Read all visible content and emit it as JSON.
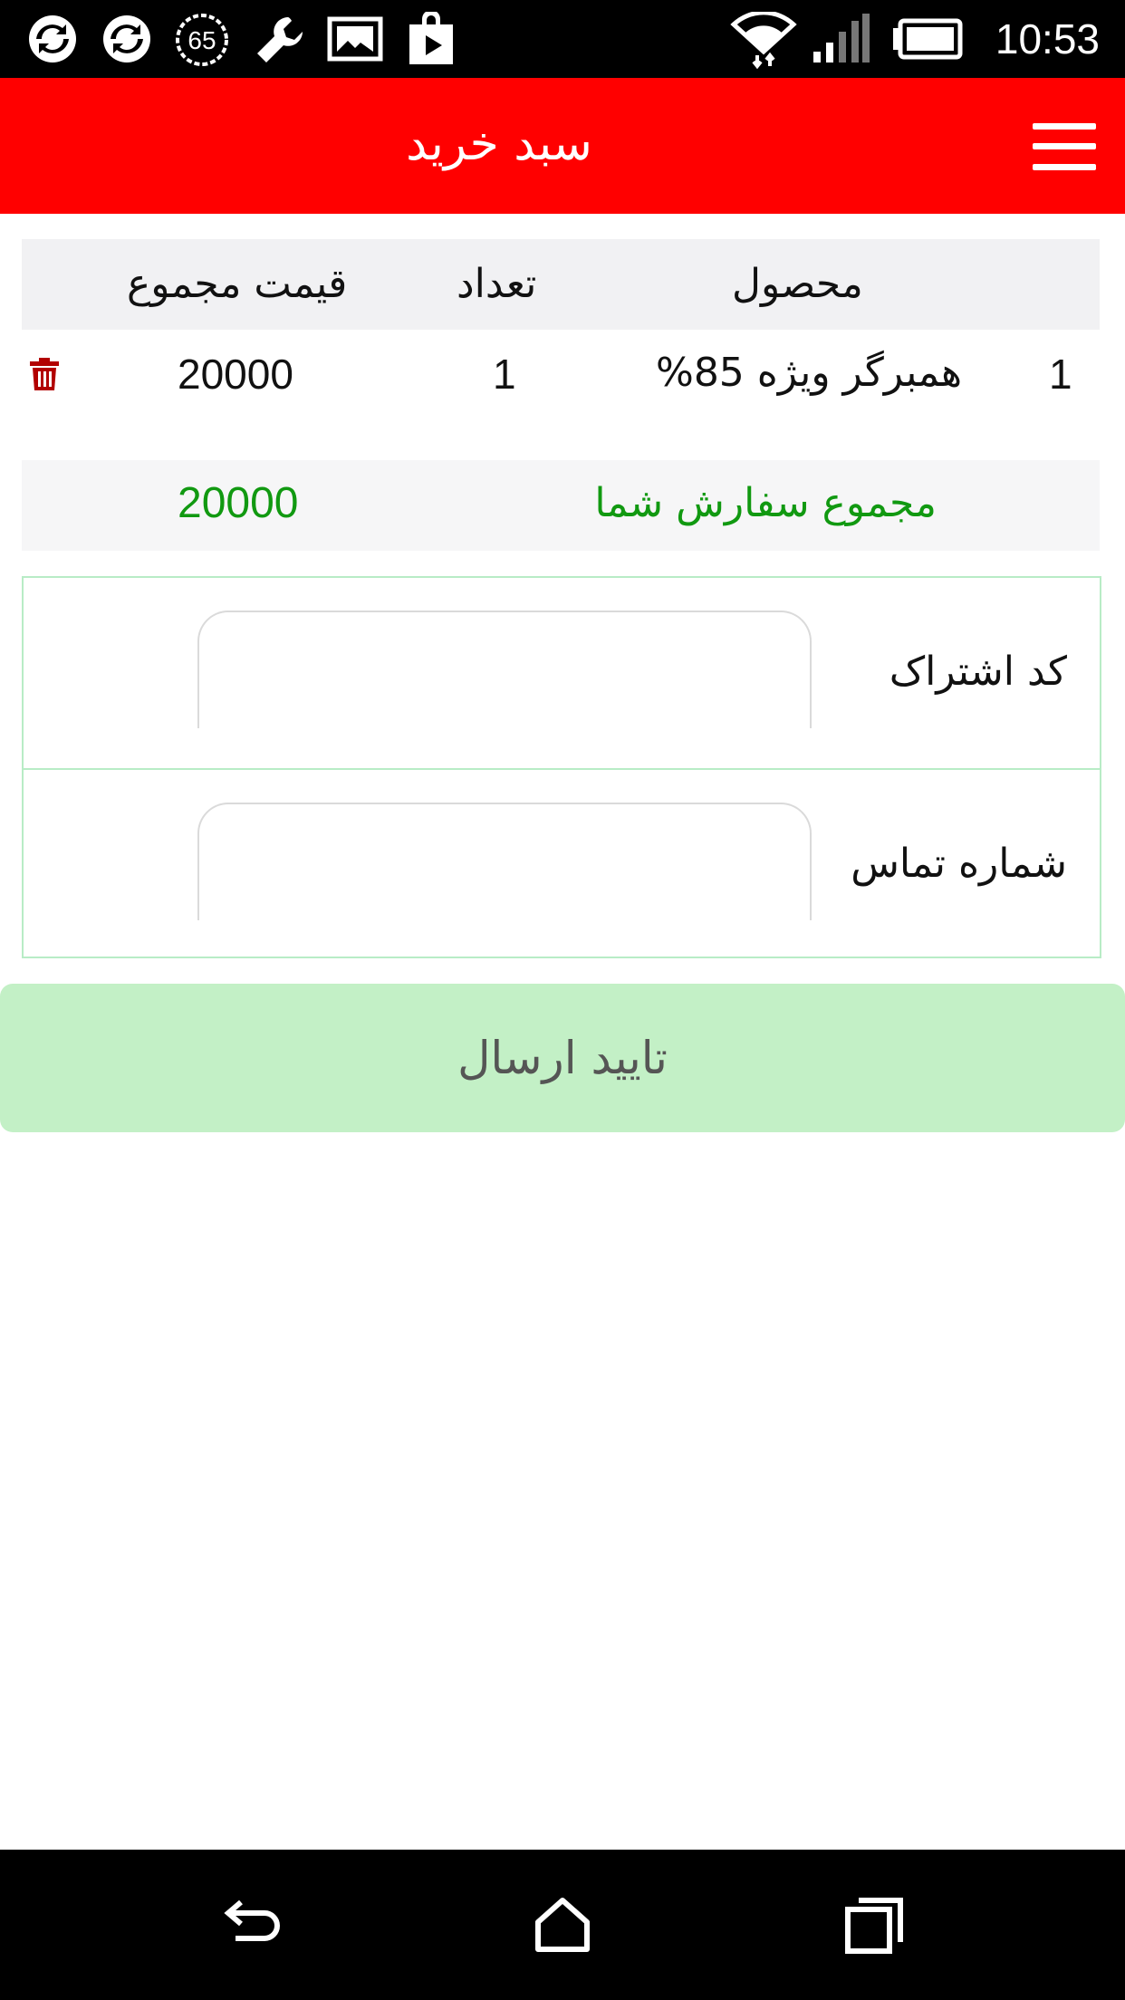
{
  "status_bar": {
    "time": "10:53",
    "badge_number": "65",
    "icons": [
      "sync-icon",
      "sync-icon",
      "badge-65-icon",
      "wrench-icon",
      "image-icon",
      "play-store-icon",
      "wifi-icon",
      "signal-icon",
      "battery-icon"
    ]
  },
  "app_bar": {
    "title": "سبد خرید",
    "menu_icon": "hamburger-menu-icon",
    "color": "#ff0000"
  },
  "cart_table": {
    "headers": {
      "product": "محصول",
      "quantity": "تعداد",
      "total_price": "قیمت مجموع"
    },
    "rows": [
      {
        "index": "1",
        "product": "همبرگر ویژه 85%",
        "quantity": "1",
        "total_price": "20000",
        "delete_icon": "trash-icon"
      }
    ]
  },
  "order_total": {
    "label": "مجموع سفارش شما",
    "value": "20000",
    "color": "#119911"
  },
  "form": {
    "subscription_code": {
      "label": "کد اشتراک",
      "value": "",
      "placeholder": ""
    },
    "phone_number": {
      "label": "شماره تماس",
      "value": "",
      "placeholder": ""
    }
  },
  "submit_button": {
    "label": "تایید ارسال",
    "color": "#c3f0c6"
  },
  "nav_bar": {
    "icons": [
      "back-icon",
      "home-icon",
      "recents-icon"
    ]
  }
}
